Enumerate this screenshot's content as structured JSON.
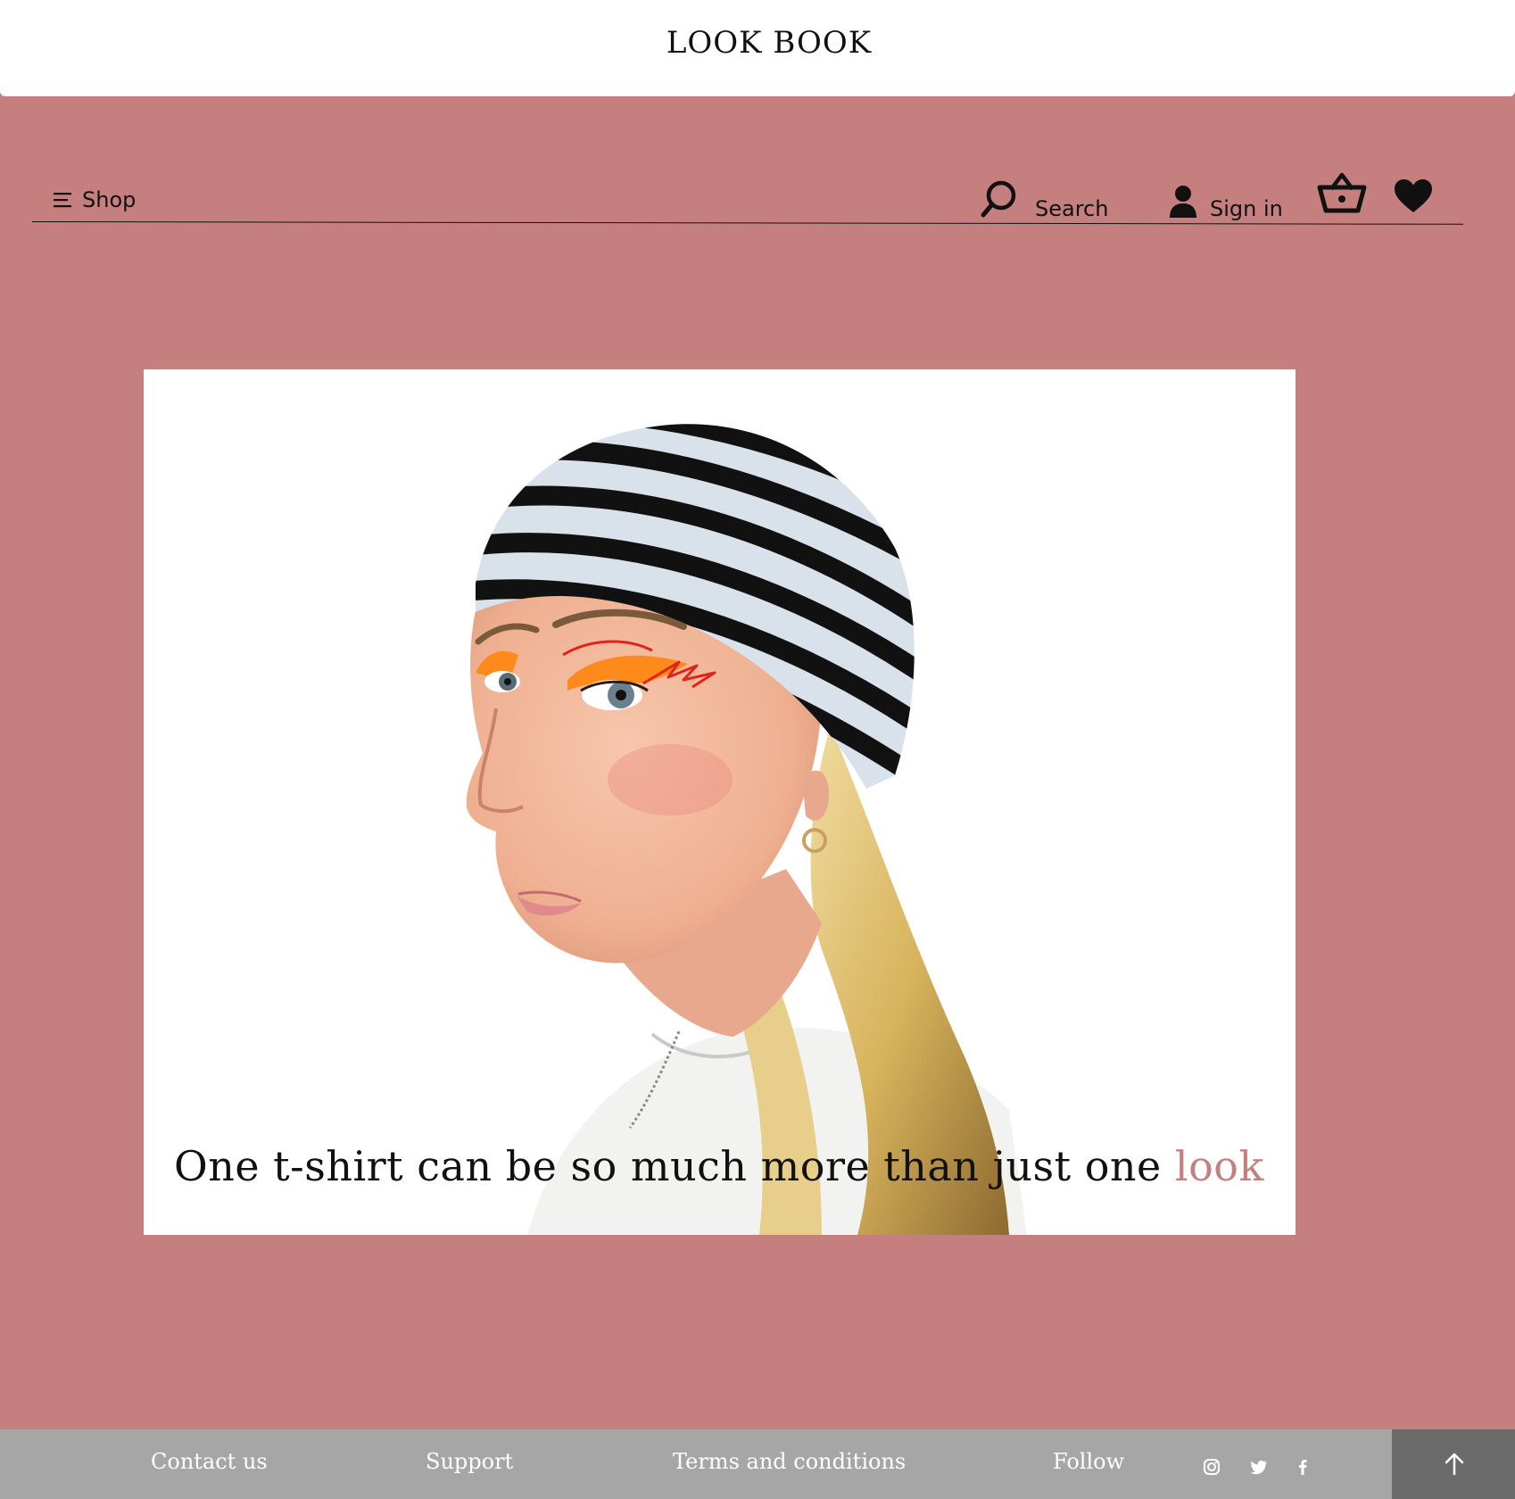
{
  "header": {
    "brand": "LOOK BOOK"
  },
  "nav": {
    "shop_label": "Shop",
    "search_label": "Search",
    "signin_label": "Sign in",
    "icons": {
      "menu": "menu-icon",
      "search": "search-icon",
      "user": "user-icon",
      "basket": "basket-icon",
      "wishlist": "heart-icon"
    }
  },
  "hero": {
    "tagline_main": "One t-shirt can be so much more than just one ",
    "tagline_accent": "look",
    "image_alt": "Model wearing a striped headscarf and white t-shirt"
  },
  "footer": {
    "links": [
      "Contact us",
      "Support",
      "Terms and conditions",
      "Follow"
    ],
    "social": [
      "instagram-icon",
      "twitter-icon",
      "facebook-icon"
    ],
    "back_to_top": "arrow-up-icon"
  },
  "colors": {
    "background": "#c67f7f",
    "accent": "#c67f7f",
    "footer": "#a6a6a6",
    "footer_button": "#6b6b6b",
    "text": "#111111"
  }
}
